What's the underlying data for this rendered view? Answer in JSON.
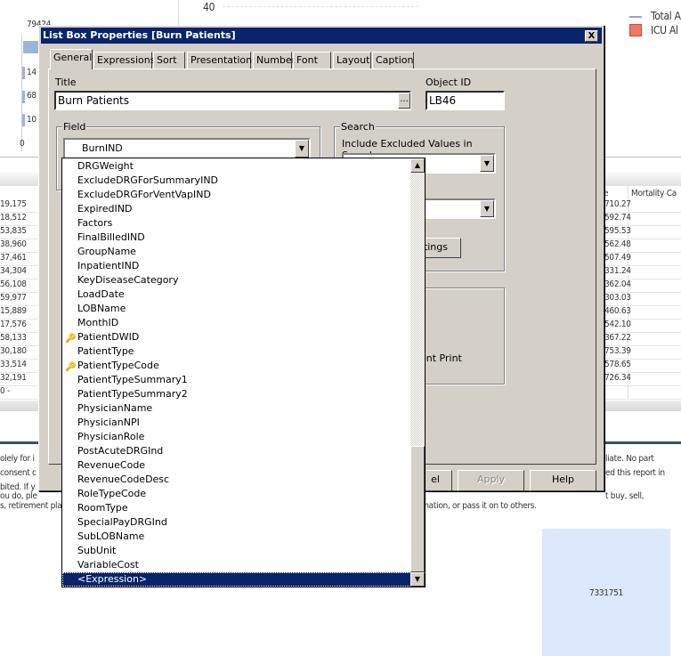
{
  "background": {
    "chart_tick": "40",
    "legend": [
      {
        "label": "Total A",
        "color": "#8fa8d0"
      },
      {
        "label": "ICU Al",
        "color": "#f07868"
      }
    ],
    "left_axis": [
      "79424",
      "14",
      "68",
      "10",
      "0"
    ],
    "mortality_header": "Mortality Ca",
    "header_fragment": "e",
    "left_values": [
      "19,175",
      "18,512",
      "53,835",
      "38,960",
      "37,461",
      "34,304",
      "56,108",
      "59,977",
      "15,889",
      "17,576",
      "58,133",
      "30,180",
      "33,514",
      "32,191",
      "0 -"
    ],
    "right_values": [
      "710.27",
      "592.74",
      "595.53",
      "562.48",
      "507.49",
      "331.24",
      "362.04",
      "303.03",
      "460.63",
      "542.10",
      "367.22",
      "753.39",
      "578.65",
      "726.34"
    ],
    "footer_left": [
      "olely for i",
      "consent c",
      "bited. If y",
      "ou do, ple",
      "s, retirement pla"
    ],
    "footer_right": [
      "liate. No part",
      "ed this report in",
      "t buy, sell,",
      "rmation, or pass it on to others."
    ],
    "kpi_value": "7331751"
  },
  "dialog": {
    "title": "List Box Properties [Burn Patients]",
    "close": "X",
    "tabs": [
      "General",
      "Expressions",
      "Sort",
      "Presentation",
      "Number",
      "Font",
      "Layout",
      "Caption"
    ],
    "active_tab": "General",
    "title_label": "Title",
    "title_value": "Burn Patients",
    "ellipsis": "...",
    "object_id_label": "Object ID",
    "object_id_value": "LB46",
    "field_group": "Field",
    "field_value": "BurnIND",
    "search_group": "Search",
    "include_excluded_label": "Include Excluded Values in Search",
    "search_mode_label_fragment": "e",
    "settings_fragment": "ttings",
    "print_fragment": "ent Print",
    "buttons": {
      "cancel": "el",
      "apply": "Apply",
      "help": "Help"
    }
  },
  "field_list": {
    "items": [
      {
        "label": "DRGWeight",
        "key": false
      },
      {
        "label": "ExcludeDRGForSummaryIND",
        "key": false
      },
      {
        "label": "ExcludeDRGForVentVapIND",
        "key": false
      },
      {
        "label": "ExpiredIND",
        "key": false
      },
      {
        "label": "Factors",
        "key": false
      },
      {
        "label": "FinalBilledIND",
        "key": false
      },
      {
        "label": "GroupName",
        "key": false
      },
      {
        "label": "InpatientIND",
        "key": false
      },
      {
        "label": "KeyDiseaseCategory",
        "key": false
      },
      {
        "label": "LoadDate",
        "key": false
      },
      {
        "label": "LOBName",
        "key": false
      },
      {
        "label": "MonthID",
        "key": false
      },
      {
        "label": "PatientDWID",
        "key": true
      },
      {
        "label": "PatientType",
        "key": false
      },
      {
        "label": "PatientTypeCode",
        "key": true
      },
      {
        "label": "PatientTypeSummary1",
        "key": false
      },
      {
        "label": "PatientTypeSummary2",
        "key": false
      },
      {
        "label": "PhysicianName",
        "key": false
      },
      {
        "label": "PhysicianNPI",
        "key": false
      },
      {
        "label": "PhysicianRole",
        "key": false
      },
      {
        "label": "PostAcuteDRGInd",
        "key": false
      },
      {
        "label": "RevenueCode",
        "key": false
      },
      {
        "label": "RevenueCodeDesc",
        "key": false
      },
      {
        "label": "RoleTypeCode",
        "key": false
      },
      {
        "label": "RoomType",
        "key": false
      },
      {
        "label": "SpecialPayDRGInd",
        "key": false
      },
      {
        "label": "SubLOBName",
        "key": false
      },
      {
        "label": "SubUnit",
        "key": false
      },
      {
        "label": "VariableCost",
        "key": false
      },
      {
        "label": "<Expression>",
        "key": false,
        "selected": true
      }
    ]
  }
}
